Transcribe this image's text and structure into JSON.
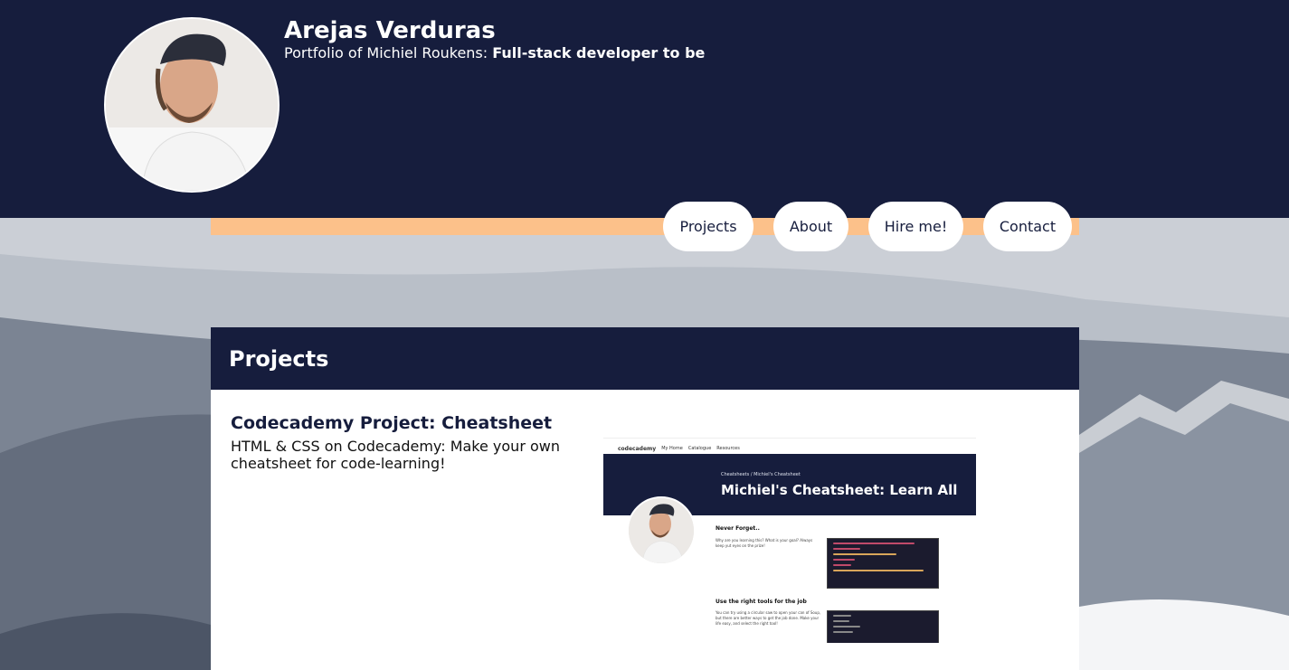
{
  "header": {
    "site_title": "Arejas Verduras",
    "tagline_prefix": "Portfolio of Michiel Roukens: ",
    "tagline_role": "Full-stack developer to be",
    "avatar_icon": "profile-photo"
  },
  "nav": {
    "items": [
      {
        "label": "Projects"
      },
      {
        "label": "About"
      },
      {
        "label": "Hire me!"
      },
      {
        "label": "Contact"
      }
    ]
  },
  "projects": {
    "heading": "Projects",
    "items": [
      {
        "title": "Codecademy Project: Cheatsheet",
        "description": "HTML & CSS on Codecademy: Make your own cheatsheet for code-learning!",
        "screenshot": {
          "nav_logo": "codecademy",
          "nav_links": [
            "My Home",
            "Catalogue",
            "Resources"
          ],
          "breadcrumb": "Cheatsheets / Michiel's Cheatsheet",
          "title": "Michiel's Cheatsheet: Learn All",
          "section_1_heading": "Never Forget..",
          "section_1_text": "Why are you learning this? What is your goal? Always keep yut eyes on the prize!",
          "section_2_heading": "Use the right tools for the job",
          "section_2_text": "You can try using a circular saw to open your can of Soup, but there are better ways to get the job done. Make your life easy, and select the right tool!"
        }
      }
    ]
  },
  "colors": {
    "navy": "#161d3d",
    "accent": "#fcc18a",
    "white": "#ffffff"
  }
}
